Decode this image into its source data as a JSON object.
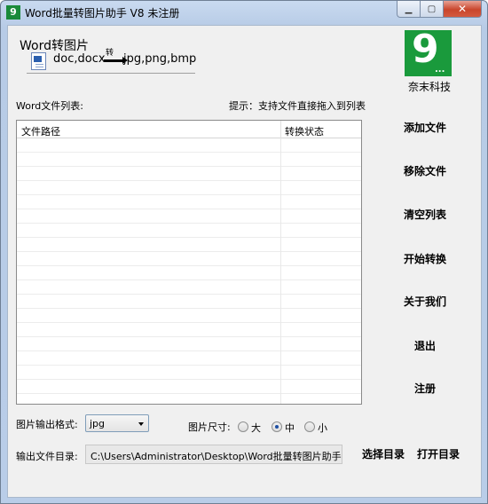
{
  "window": {
    "title": "Word批量转图片助手 V8 未注册",
    "app_icon_glyph": "9",
    "min_glyph": "▁",
    "max_glyph": "▢",
    "close_glyph": "✕"
  },
  "header": {
    "title": "Word转图片",
    "from_formats": "doc,docx",
    "arrow_label": "转",
    "to_formats": "jpg,png,bmp",
    "doc_icon": "word-document-icon"
  },
  "logo": {
    "glyph": "9",
    "dots": "...",
    "name": "奈末科技",
    "color": "#1a9a3c"
  },
  "list": {
    "label": "Word文件列表:",
    "hint": "提示：支持文件直接拖入到列表",
    "columns": [
      "文件路径",
      "转换状态"
    ]
  },
  "side_buttons": [
    "添加文件",
    "移除文件",
    "清空列表",
    "开始转换",
    "关于我们",
    "退出",
    "注册"
  ],
  "format": {
    "label": "图片输出格式:",
    "selected": "jpg"
  },
  "size": {
    "label": "图片尺寸:",
    "options": [
      "大",
      "中",
      "小"
    ],
    "selected_index": 1
  },
  "output": {
    "label": "输出文件目录:",
    "path": "C:\\Users\\Administrator\\Desktop\\Word批量转图片助手",
    "choose_label": "选择目录",
    "open_label": "打开目录"
  }
}
